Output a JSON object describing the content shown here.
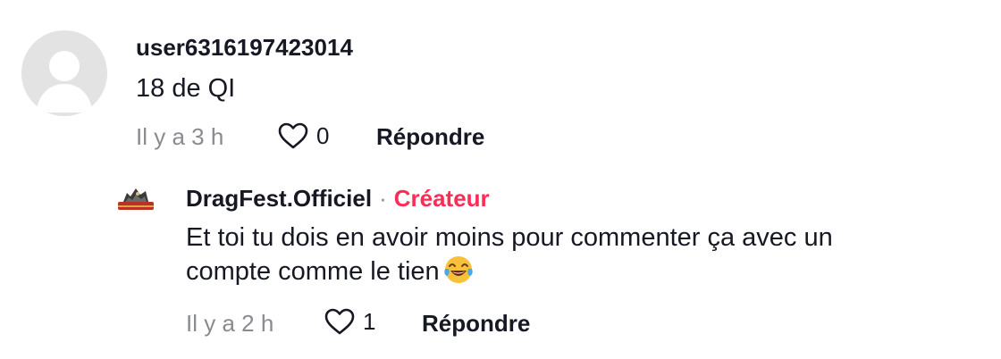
{
  "comment": {
    "username": "user6316197423014",
    "text": "18 de QI",
    "time": "Il y a 3 h",
    "like_count": "0",
    "reply_label": "Répondre"
  },
  "reply": {
    "username": "DragFest.Officiel",
    "separator": "·",
    "creator_badge": "Créateur",
    "text_line1": "Et toi tu dois en avoir moins pour commenter ça avec un",
    "text_line2": "compte comme le tien",
    "emoji": "face-with-tears-of-joy",
    "time": "Il y a 2 h",
    "like_count": "1",
    "reply_label": "Répondre"
  },
  "colors": {
    "creator_badge": "#fe2c55",
    "secondary_text": "#8a8b91",
    "avatar_placeholder": "#e3e3e4"
  }
}
